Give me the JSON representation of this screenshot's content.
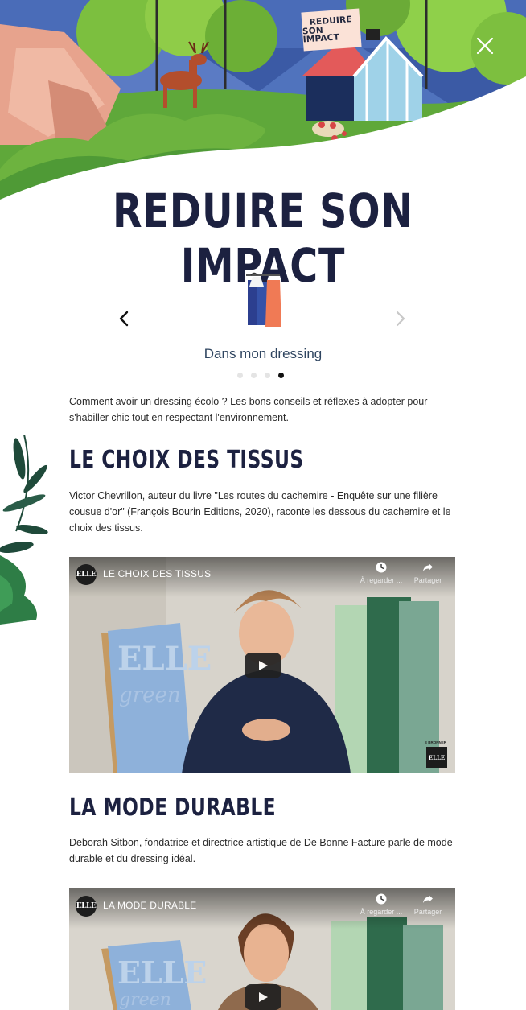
{
  "hero": {
    "sign_line1": "REDUIRE",
    "sign_line2": "SON IMPACT",
    "close_label": "×"
  },
  "page": {
    "title": "REDUIRE SON IMPACT"
  },
  "carousel": {
    "label": "Dans mon dressing",
    "prev_icon": "chevron-left-icon",
    "next_icon": "chevron-right-icon",
    "image": "clothes-rack-icon",
    "dots": [
      false,
      false,
      false,
      true
    ]
  },
  "intro": "Comment avoir un dressing écolo ? Les bons conseils et réflexes à adopter pour s'habiller chic tout en respectant l'environnement.",
  "sections": [
    {
      "title": "LE CHOIX DES TISSUS",
      "text": "Victor Chevrillon, auteur du livre \"Les routes du cachemire - Enquête sur une filière cousue d'or\" (François Bourin Editions, 2020), raconte les dessous du cachemire et le choix des tissus.",
      "video": {
        "channel_logo": "ELLE",
        "title": "LE CHOIX DES TISSUS",
        "watch_later": "À regarder ...",
        "share": "Partager",
        "brand_badge": "ELLE",
        "brand_small": "E BRONNER"
      }
    },
    {
      "title": "LA MODE DURABLE",
      "text": "Deborah Sitbon, fondatrice et directrice artistique de De Bonne Facture parle de mode durable et du dressing idéal.",
      "video": {
        "channel_logo": "ELLE",
        "title": "LA MODE DURABLE",
        "watch_later": "À regarder ...",
        "share": "Partager"
      }
    }
  ],
  "colors": {
    "title_navy": "#1c2140",
    "carousel_label": "#2f4560",
    "sky": "#3f5fa8",
    "green": "#6db33f",
    "house_red": "#e35a5a"
  }
}
